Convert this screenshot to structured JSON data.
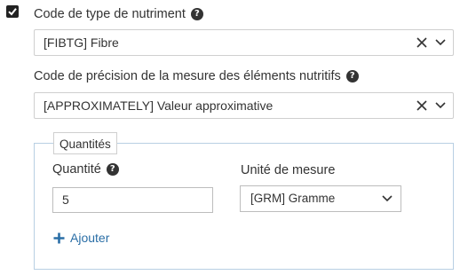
{
  "nutrient_type": {
    "label": "Code de type de nutriment",
    "value": "[FIBTG] Fibre"
  },
  "precision": {
    "label": "Code de précision de la mesure des éléments nutritifs",
    "value": "[APPROXIMATELY] Valeur approximative"
  },
  "quantities": {
    "legend": "Quantités",
    "quantity_label": "Quantité",
    "quantity_value": "5",
    "unit_label": "Unité de mesure",
    "unit_value": "[GRM] Gramme",
    "add_label": "Ajouter"
  },
  "help_glyph": "?",
  "colors": {
    "link": "#2a6ea6",
    "fieldset_border": "#b8cfe3"
  }
}
